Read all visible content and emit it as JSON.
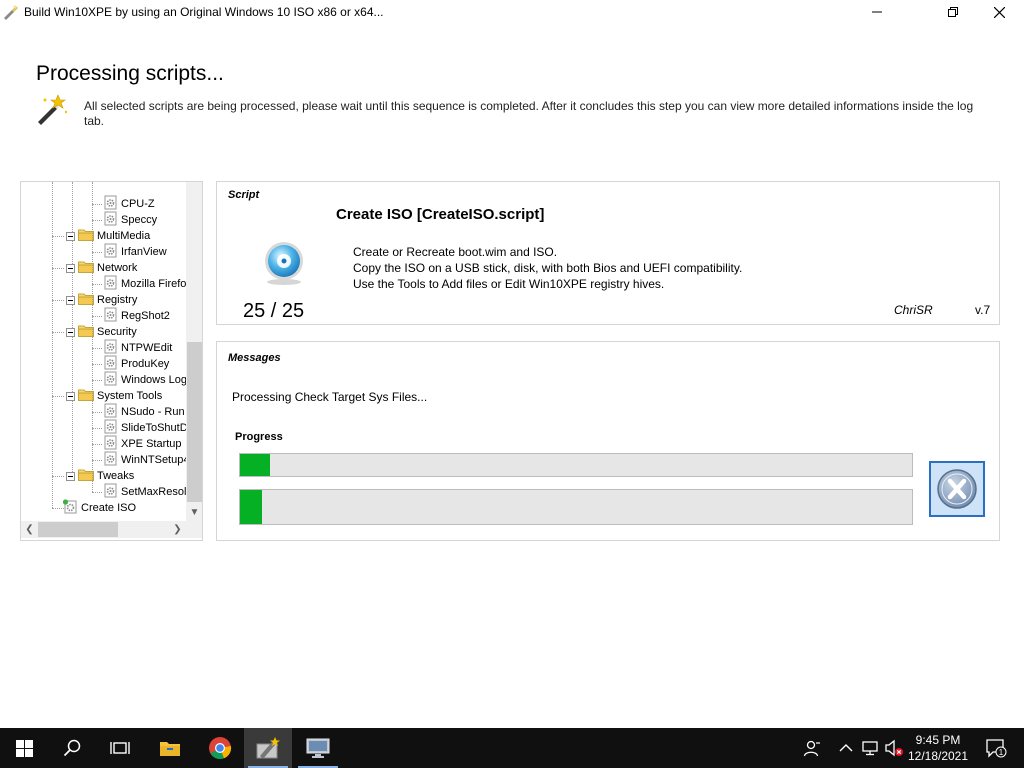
{
  "window": {
    "title": "Build Win10XPE by using an Original Windows 10 ISO x86 or x64...",
    "minimize_glyph": "minimize-icon",
    "maximize_glyph": "restore-icon",
    "close_glyph": "close-icon"
  },
  "header": {
    "title": "Processing scripts...",
    "description": "All selected scripts are being processed, please wait until this sequence is completed. After it concludes this step you can view more detailed informations inside the log tab."
  },
  "tree": {
    "items": [
      {
        "label": "CPU-Z",
        "type": "script",
        "level": 2
      },
      {
        "label": "Speccy",
        "type": "script",
        "level": 2
      },
      {
        "label": "MultiMedia",
        "type": "folder",
        "level": 1
      },
      {
        "label": "IrfanView",
        "type": "script",
        "level": 2
      },
      {
        "label": "Network",
        "type": "folder",
        "level": 1
      },
      {
        "label": "Mozilla Firefo",
        "type": "script",
        "level": 2
      },
      {
        "label": "Registry",
        "type": "folder",
        "level": 1
      },
      {
        "label": "RegShot2",
        "type": "script",
        "level": 2
      },
      {
        "label": "Security",
        "type": "folder",
        "level": 1
      },
      {
        "label": "NTPWEdit",
        "type": "script",
        "level": 2
      },
      {
        "label": "ProduKey",
        "type": "script",
        "level": 2
      },
      {
        "label": "Windows Log",
        "type": "script",
        "level": 2
      },
      {
        "label": "System Tools",
        "type": "folder",
        "level": 1
      },
      {
        "label": "NSudo - Run",
        "type": "script",
        "level": 2
      },
      {
        "label": "SlideToShutD",
        "type": "script",
        "level": 2
      },
      {
        "label": "XPE Startup",
        "type": "script",
        "level": 2
      },
      {
        "label": "WinNTSetup4",
        "type": "script",
        "level": 2
      },
      {
        "label": "Tweaks",
        "type": "folder",
        "level": 1
      },
      {
        "label": "SetMaxResol",
        "type": "script",
        "level": 2
      },
      {
        "label": "Create ISO",
        "type": "script",
        "level": 0
      }
    ]
  },
  "script": {
    "section_label": "Script",
    "title": "Create ISO [CreateISO.script]",
    "description_lines": [
      "Create or Recreate boot.wim and ISO.",
      "Copy the ISO on a USB stick, disk, with both Bios and UEFI compatibility.",
      "Use the Tools to Add files or Edit Win10XPE registry hives."
    ],
    "counter": "25 / 25",
    "author": "ChriSR",
    "version": "v.7"
  },
  "messages": {
    "section_label": "Messages",
    "text": "Processing Check Target Sys Files...",
    "progress_label": "Progress",
    "progress_1": 0.045,
    "progress_2": 0.033,
    "cancel_icon": "cancel-x-icon"
  },
  "taskbar": {
    "apps": [
      "start-icon",
      "search-icon",
      "task-view-icon",
      "file-explorer-icon",
      "chrome-icon",
      "builder-icon",
      "display-icon"
    ],
    "tray": [
      "people-icon",
      "chevron-up-icon",
      "network-icon",
      "volume-muted-icon"
    ],
    "time": "9:45 PM",
    "date": "12/18/2021",
    "notification_count": "1"
  },
  "colors": {
    "progress_fill": "#06b025",
    "progress_bg": "#e6e6e6",
    "taskbar_bg": "#101010",
    "cancel_border": "#2a6fc2"
  }
}
